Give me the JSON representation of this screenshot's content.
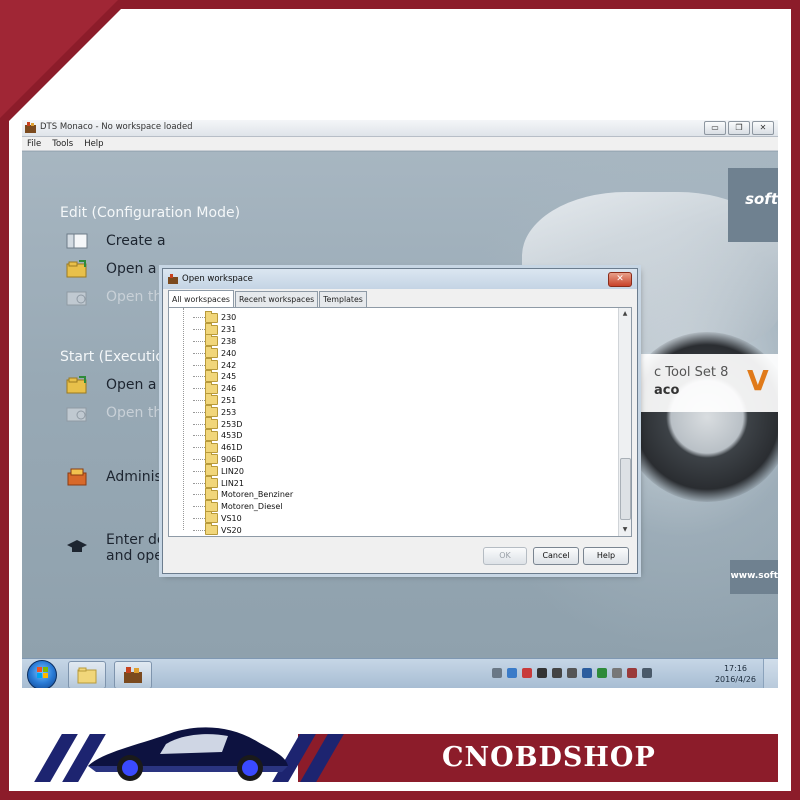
{
  "window": {
    "title": "DTS Monaco - No workspace loaded",
    "controls": {
      "minimize": "▭",
      "maximize": "❐",
      "close": "✕"
    }
  },
  "menu": [
    "File",
    "Tools",
    "Help"
  ],
  "main": {
    "edit_section_title": "Edit (Configuration Mode)",
    "start_section_title": "Start (Executio",
    "actions": {
      "create": "Create a",
      "open_edit": "Open a",
      "open_edit_disabled": "Open th",
      "open_start": "Open a",
      "open_start_disabled": "Open th",
      "admin": "Adminis",
      "demo_line1": "Enter demonstration mode",
      "demo_line2": "and open the example workspace"
    },
    "branding": {
      "softing": "soft",
      "product_line1": "c Tool Set 8",
      "product_line2": "aco",
      "v_mark": "V",
      "website": "www.soft"
    }
  },
  "dialog": {
    "title": "Open workspace",
    "close_label": "✕",
    "tabs": [
      "All workspaces",
      "Recent workspaces",
      "Templates"
    ],
    "active_tab": "All workspaces",
    "folders": [
      "230",
      "231",
      "238",
      "240",
      "242",
      "245",
      "246",
      "251",
      "253",
      "253D",
      "453D",
      "461D",
      "906D",
      "LIN20",
      "LIN21",
      "Motoren_Benziner",
      "Motoren_Diesel",
      "VS10",
      "VS20"
    ],
    "buttons": {
      "ok": "OK",
      "cancel": "Cancel",
      "help": "Help"
    }
  },
  "taskbar": {
    "time": "17:16",
    "date": "2016/4/26"
  },
  "watermark": {
    "brand": "CNOBDSHOP"
  },
  "colors": {
    "frame": "#8c1c2a",
    "stripe": "#1d2470",
    "accent_orange": "#e07a1a"
  }
}
